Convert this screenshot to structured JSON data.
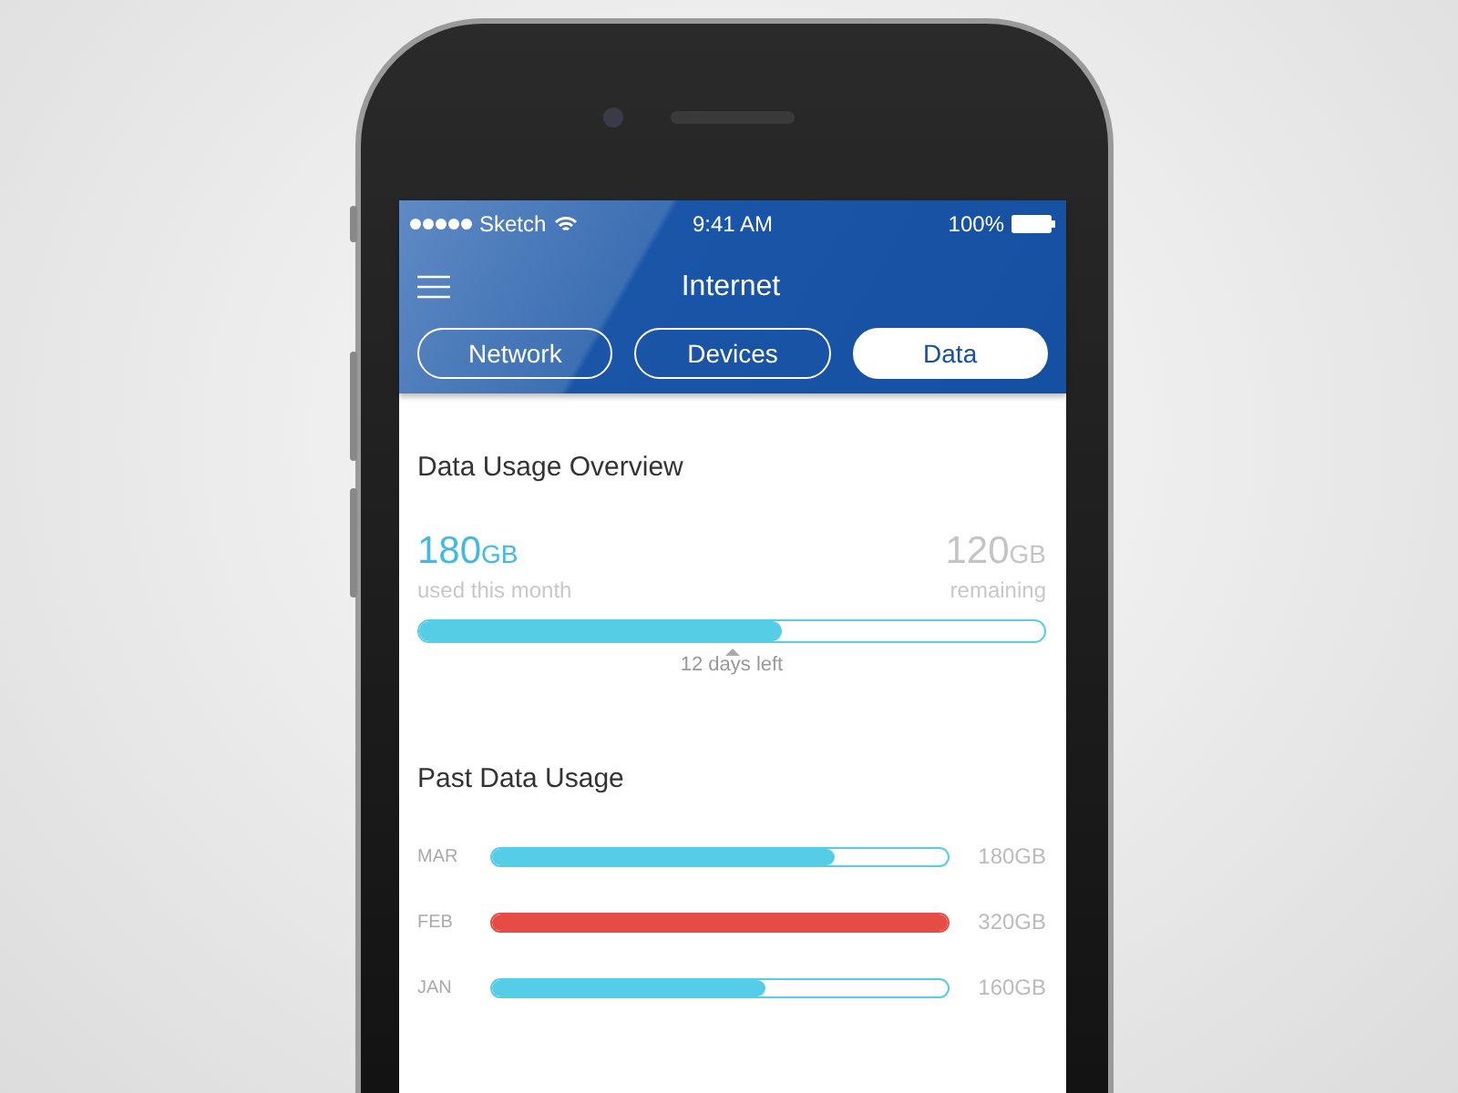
{
  "status_bar": {
    "carrier": "Sketch",
    "time": "9:41 AM",
    "battery": "100%"
  },
  "nav": {
    "title": "Internet"
  },
  "tabs": [
    {
      "label": "Network",
      "selected": false
    },
    {
      "label": "Devices",
      "selected": false
    },
    {
      "label": "Data",
      "selected": true
    }
  ],
  "overview": {
    "title": "Data Usage Overview",
    "used": {
      "value": "180",
      "unit": "GB",
      "caption": "used this month"
    },
    "remaining": {
      "value": "120",
      "unit": "GB",
      "caption": "remaining"
    },
    "level": 0.58,
    "note": "12 days left"
  },
  "past": {
    "title": "Past Data Usage",
    "rows": [
      {
        "month": "MAR",
        "level": 0.75,
        "color": "#56cde6",
        "amount": "180GB"
      },
      {
        "month": "FEB",
        "level": 1,
        "color": "#e64c45",
        "amount": "320GB"
      },
      {
        "month": "JAN",
        "level": 0.6,
        "color": "#56cde6",
        "amount": "160GB"
      }
    ]
  }
}
